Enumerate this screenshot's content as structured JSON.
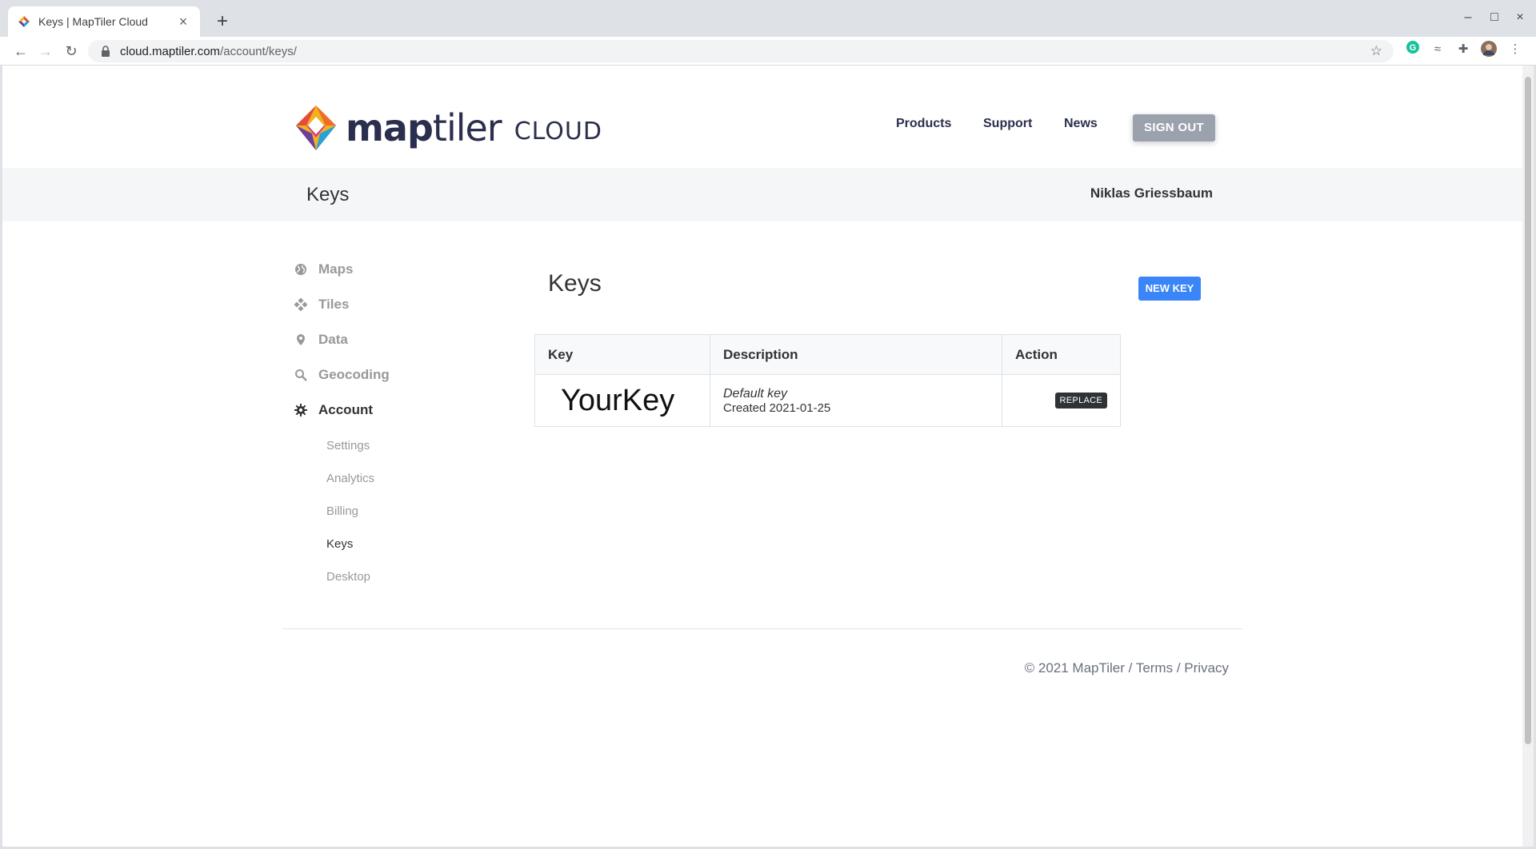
{
  "browser": {
    "tab_title": "Keys | MapTiler Cloud",
    "url_host": "cloud.maptiler.com",
    "url_path": "/account/keys/"
  },
  "header": {
    "logo_bold": "map",
    "logo_light": "tiler",
    "logo_suffix": "CLOUD",
    "nav": [
      "Products",
      "Support",
      "News"
    ],
    "signout_label": "SIGN OUT"
  },
  "titlebar": {
    "title": "Keys",
    "user_name": "Niklas Griessbaum"
  },
  "sidebar": {
    "items": [
      {
        "label": "Maps",
        "icon": "globe-icon"
      },
      {
        "label": "Tiles",
        "icon": "tiles-icon"
      },
      {
        "label": "Data",
        "icon": "map-pin-icon"
      },
      {
        "label": "Geocoding",
        "icon": "search-icon"
      },
      {
        "label": "Account",
        "icon": "gear-icon"
      }
    ],
    "sub_items": [
      "Settings",
      "Analytics",
      "Billing",
      "Keys",
      "Desktop"
    ]
  },
  "main": {
    "title": "Keys",
    "new_key_label": "NEW KEY",
    "table": {
      "headers": [
        "Key",
        "Description",
        "Action"
      ],
      "rows": [
        {
          "key": "YourKey",
          "description": "Default key",
          "created": "Created 2021-01-25",
          "action": "REPLACE"
        }
      ]
    }
  },
  "footer": {
    "copyright": "© 2021 MapTiler",
    "sep": " / ",
    "terms": "Terms",
    "privacy": "Privacy"
  },
  "colors": {
    "brand_dark": "#2b2f4e",
    "accent_blue": "#3a86f8",
    "signout_gray": "#9ba2ad"
  }
}
